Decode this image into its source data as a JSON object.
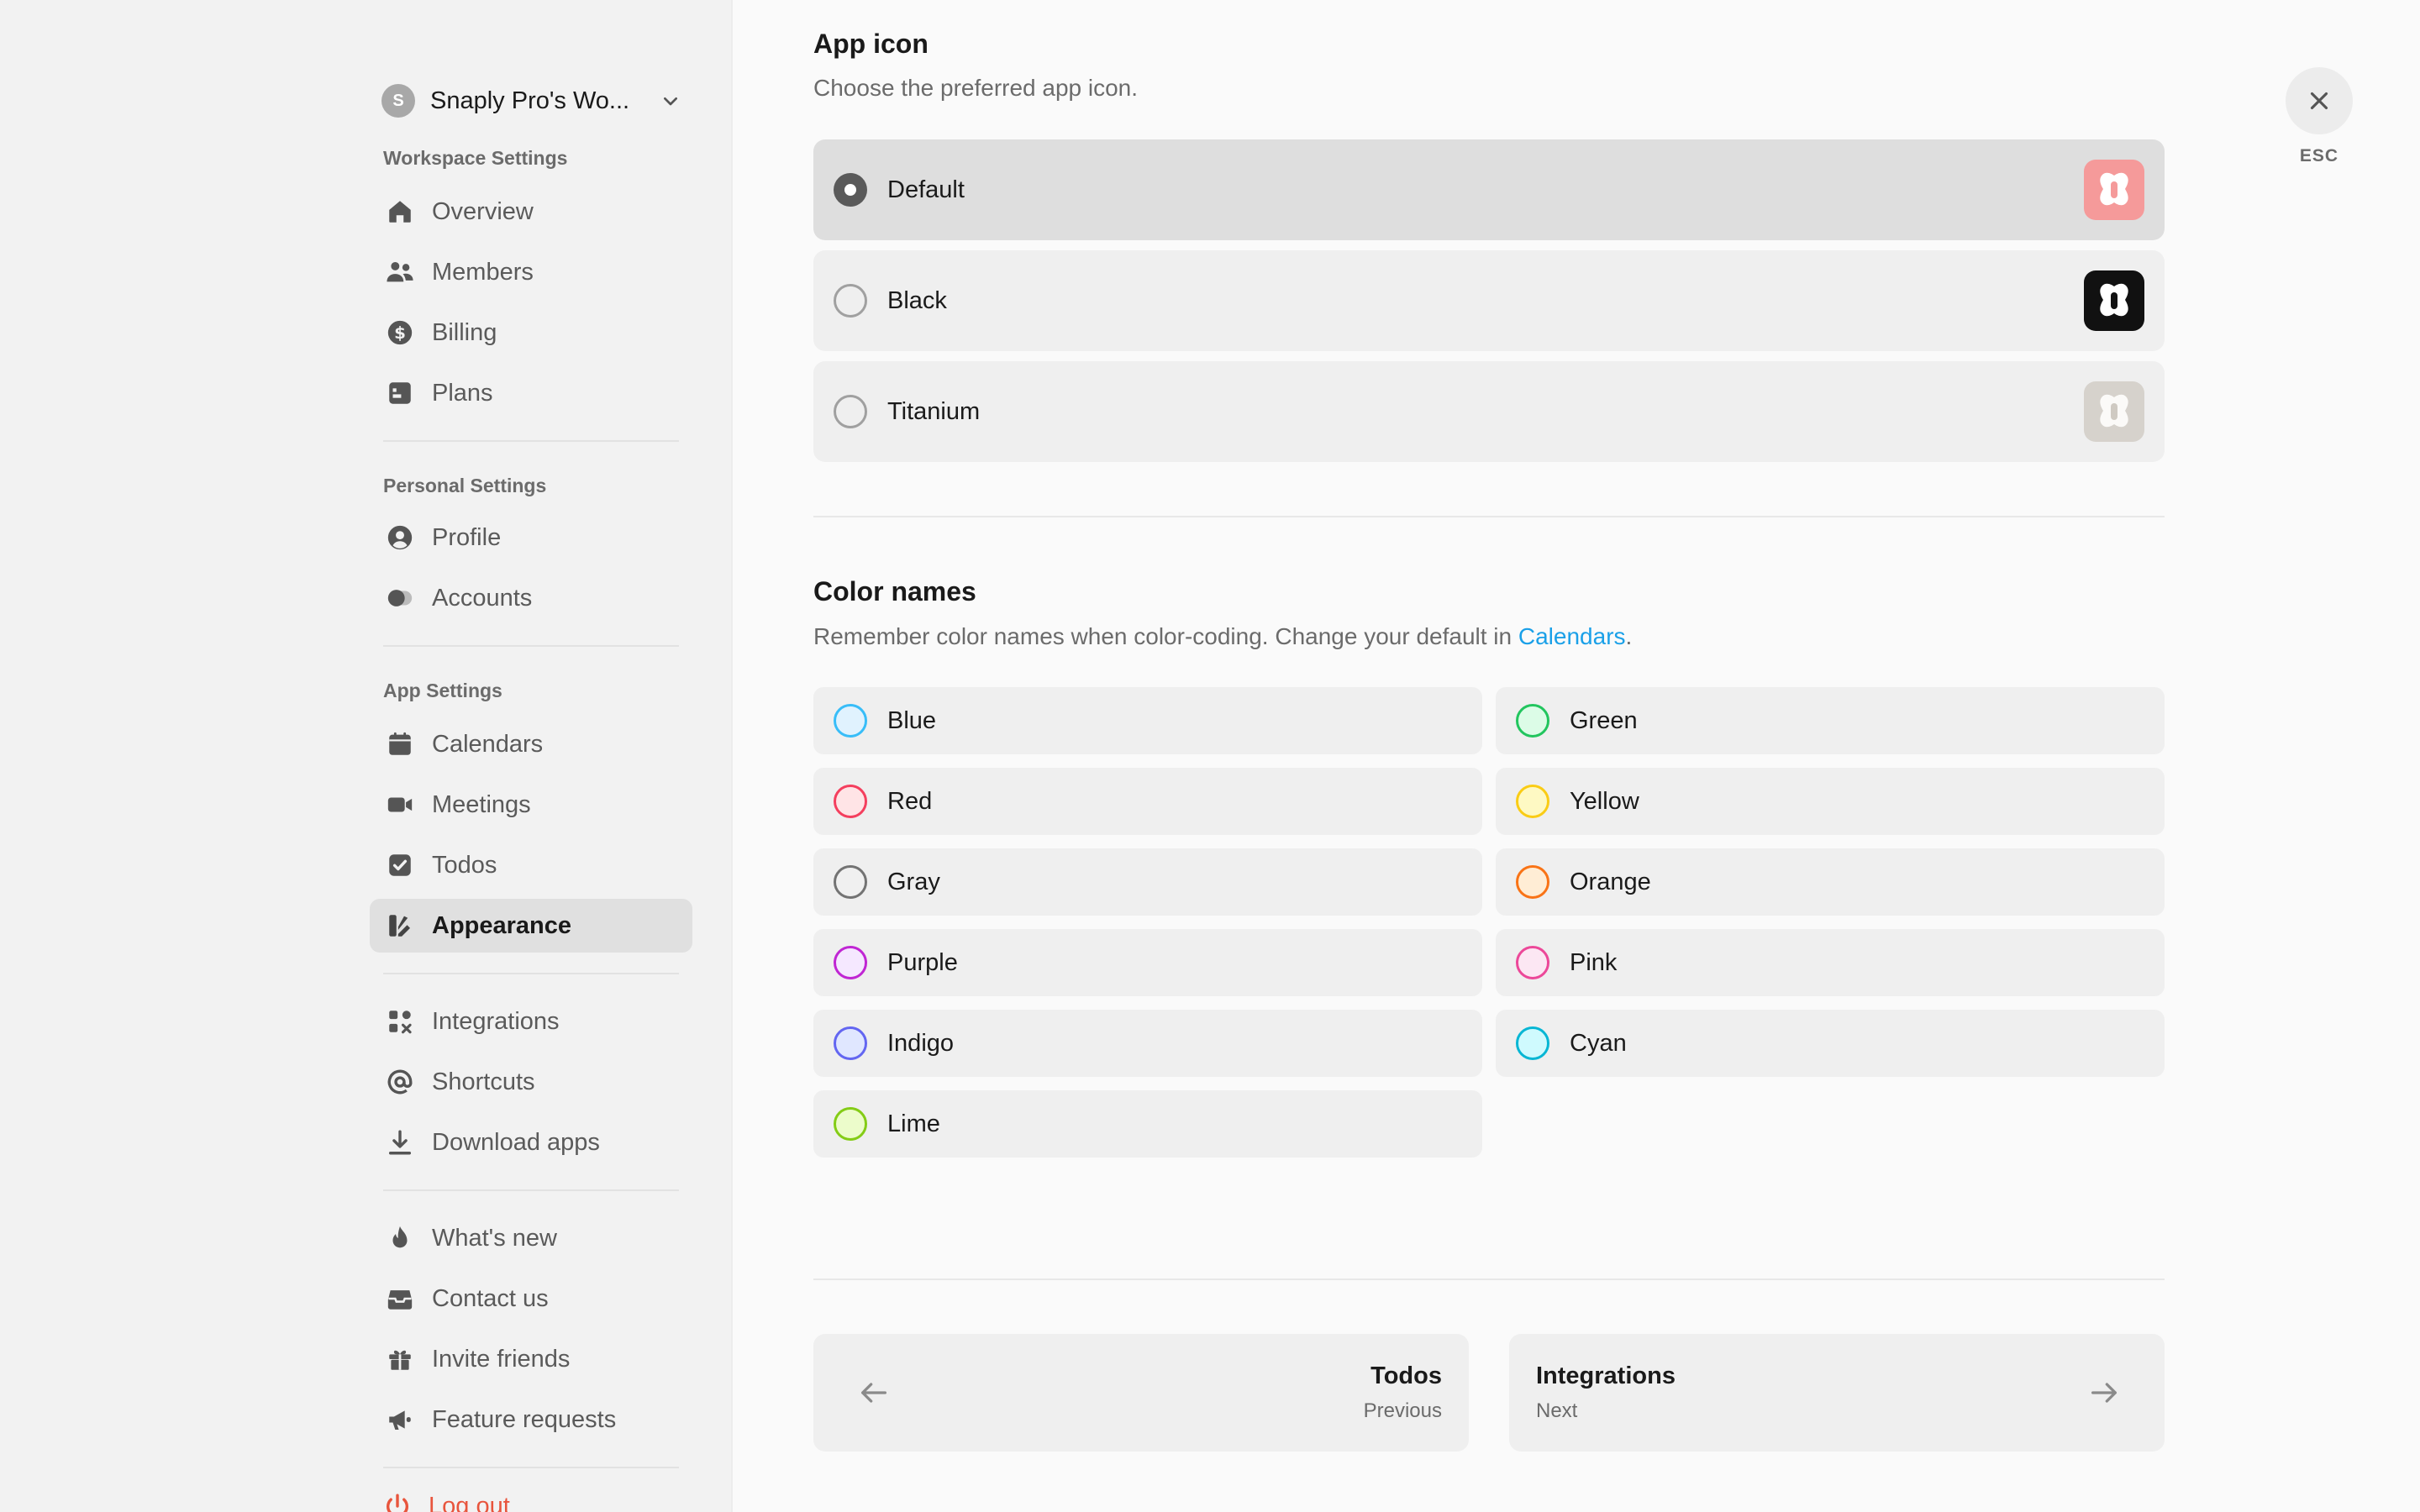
{
  "workspace": {
    "avatar_letter": "S",
    "name": "Snaply Pro's Wo..."
  },
  "sidebar": {
    "sections": [
      {
        "label": "Workspace Settings"
      },
      {
        "label": "Personal Settings"
      },
      {
        "label": "App Settings"
      }
    ],
    "items": [
      {
        "label": "Overview",
        "icon": "home-icon"
      },
      {
        "label": "Members",
        "icon": "users-icon"
      },
      {
        "label": "Billing",
        "icon": "dollar-icon"
      },
      {
        "label": "Plans",
        "icon": "plans-icon"
      },
      {
        "label": "Profile",
        "icon": "user-circle-icon"
      },
      {
        "label": "Accounts",
        "icon": "toggle-icon"
      },
      {
        "label": "Calendars",
        "icon": "calendar-icon"
      },
      {
        "label": "Meetings",
        "icon": "video-icon"
      },
      {
        "label": "Todos",
        "icon": "checkbox-icon"
      },
      {
        "label": "Appearance",
        "icon": "palette-icon",
        "active": true
      },
      {
        "label": "Integrations",
        "icon": "integrations-icon"
      },
      {
        "label": "Shortcuts",
        "icon": "at-icon"
      },
      {
        "label": "Download apps",
        "icon": "download-icon"
      },
      {
        "label": "What's new",
        "icon": "flame-icon"
      },
      {
        "label": "Contact us",
        "icon": "inbox-icon"
      },
      {
        "label": "Invite friends",
        "icon": "gift-icon"
      },
      {
        "label": "Feature requests",
        "icon": "megaphone-icon"
      }
    ],
    "logout_label": "Log out"
  },
  "app_icon": {
    "title": "App icon",
    "description": "Choose the preferred app icon.",
    "options": [
      {
        "label": "Default",
        "selected": true,
        "thumb_bg": "#f59a9a"
      },
      {
        "label": "Black",
        "selected": false,
        "thumb_bg": "#111111"
      },
      {
        "label": "Titanium",
        "selected": false,
        "thumb_bg": "#d6d2cc"
      }
    ]
  },
  "color_names": {
    "title": "Color names",
    "description_prefix": "Remember color names when color-coding. Change your default in ",
    "description_link": "Calendars",
    "description_suffix": ".",
    "colors": [
      {
        "label": "Blue",
        "ring": "#38bdf8",
        "fill": "#e0f2fe"
      },
      {
        "label": "Green",
        "ring": "#22c55e",
        "fill": "#dcfce7"
      },
      {
        "label": "Red",
        "ring": "#f43f5e",
        "fill": "#ffe4e6"
      },
      {
        "label": "Yellow",
        "ring": "#facc15",
        "fill": "#fef9c3"
      },
      {
        "label": "Gray",
        "ring": "#737373",
        "fill": "#f0f0f0"
      },
      {
        "label": "Orange",
        "ring": "#f97316",
        "fill": "#ffedd5"
      },
      {
        "label": "Purple",
        "ring": "#c026d3",
        "fill": "#f5e8ff"
      },
      {
        "label": "Pink",
        "ring": "#ec4899",
        "fill": "#fce7f3"
      },
      {
        "label": "Indigo",
        "ring": "#6366f1",
        "fill": "#e0e7ff"
      },
      {
        "label": "Cyan",
        "ring": "#06b6d4",
        "fill": "#cffafe"
      },
      {
        "label": "Lime",
        "ring": "#84cc16",
        "fill": "#ecfccb"
      }
    ]
  },
  "pager": {
    "prev_title": "Todos",
    "prev_sub": "Previous",
    "next_title": "Integrations",
    "next_sub": "Next"
  },
  "close": {
    "esc_label": "ESC"
  }
}
